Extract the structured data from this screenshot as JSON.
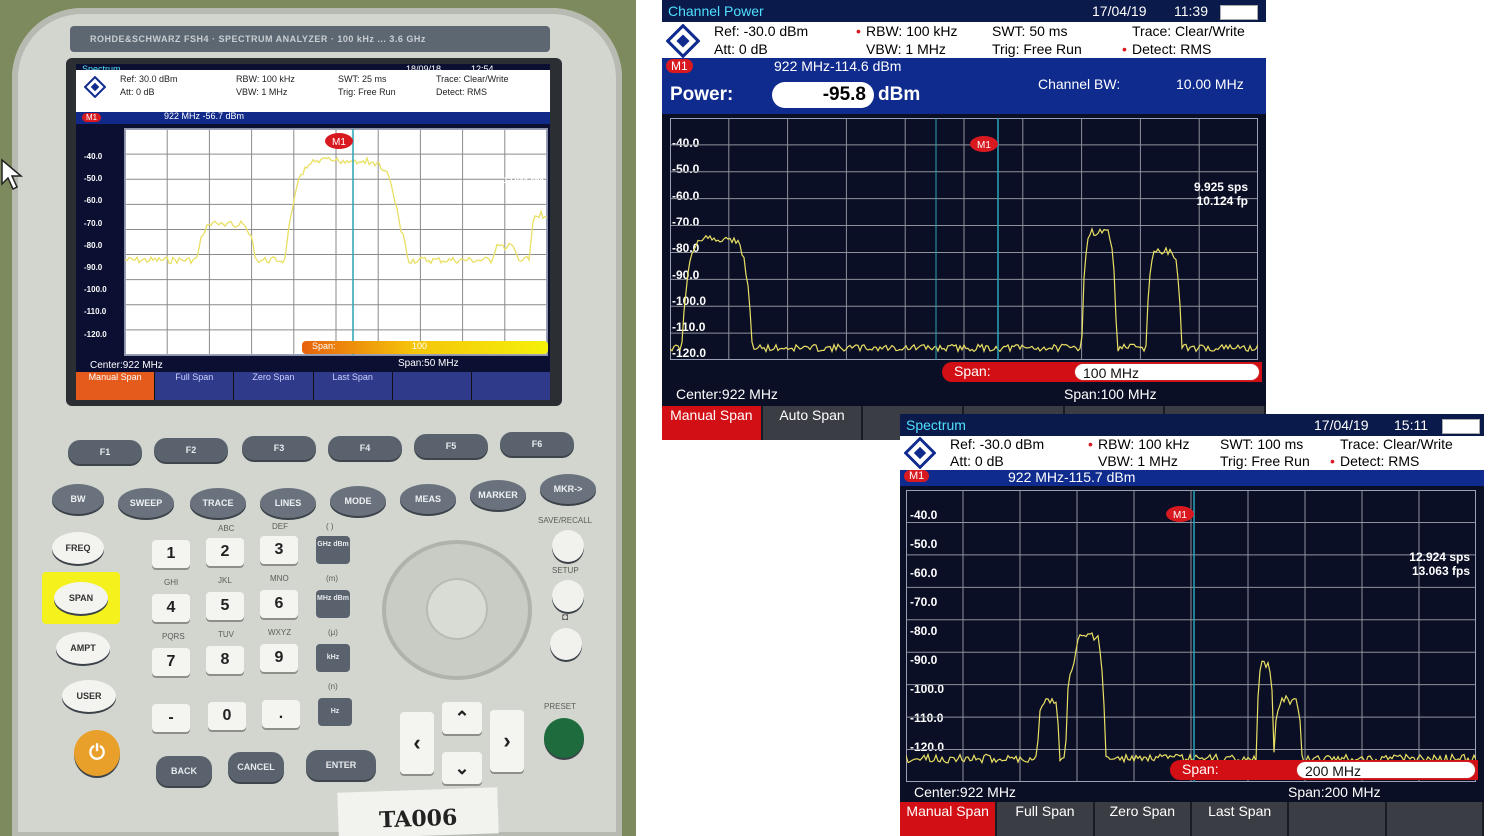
{
  "device": {
    "brand": "ROHDE&SCHWARZ  FSH4 · SPECTRUM ANALYZER · 100 kHz ... 3.6 GHz",
    "asset_tag": "TA006",
    "screen": {
      "mode": "Spectrum",
      "date": "18/09/18",
      "time": "12:54",
      "ref": "Ref:  30.0 dBm",
      "att": "Att:  0 dB",
      "rbw": "RBW:   100 kHz",
      "vbw": "VBW:   1 MHz",
      "swt": "SWT:   25 ms",
      "trig": "Trig:   Free Run",
      "trace": "Trace:   Clear/Write",
      "detect": "Detect:  RMS",
      "marker_badge": "M1",
      "marker_readout": "922  MHz  -56.7  dBm",
      "y_ticks": [
        "-40.0",
        "-50.0",
        "-60.0",
        "-70.0",
        "-80.0",
        "-90.0",
        "-100.0",
        "-110.0",
        "-120.0"
      ],
      "sweep_info": [
        "12.944 sps",
        "13.010 fps"
      ],
      "center": "Center:922 MHz",
      "span": "Span:50 MHz",
      "span_field_label": "Span:",
      "span_field_value": "100",
      "softkeys": [
        "Manual Span",
        "Full Span",
        "Zero Span",
        "Last Span",
        "",
        ""
      ]
    },
    "fkeys": [
      "F1",
      "F2",
      "F3",
      "F4",
      "F5",
      "F6"
    ],
    "func_keys": [
      "BW",
      "SWEEP",
      "TRACE",
      "LINES",
      "MODE",
      "MEAS",
      "MARKER",
      "MKR->"
    ],
    "side_keys": [
      "FREQ",
      "SPAN",
      "AMPT",
      "USER"
    ],
    "numpad": [
      "1",
      "2",
      "3",
      "4",
      "5",
      "6",
      "7",
      "8",
      "9",
      "-",
      "0",
      "."
    ],
    "numpad_letters": [
      "ABC",
      "DEF",
      "GHI",
      "JKL",
      "MNO",
      "PQRS",
      "TUV",
      "WXYZ"
    ],
    "unit_keys": [
      "GHz dBm",
      "MHz dBm",
      "kHz",
      "Hz"
    ],
    "unit_letters": [
      "( )",
      "(m)",
      "(μ)",
      "(n)"
    ],
    "bottom_keys": [
      "BACK",
      "CANCEL",
      "ENTER"
    ],
    "right_labels": [
      "SAVE/RECALL",
      "SETUP",
      "PRESET"
    ]
  },
  "channel_power": {
    "title": "Channel Power",
    "date": "17/04/19",
    "time": "11:39",
    "ref": "Ref:  -30.0 dBm",
    "att": "Att:  0 dB",
    "rbw": "RBW:   100 kHz",
    "vbw": "VBW:   1 MHz",
    "swt": "SWT:   50 ms",
    "trig": "Trig:   Free Run",
    "trace": "Trace:   Clear/Write",
    "detect": "Detect:  RMS",
    "marker_badge": "M1",
    "marker_readout": "922  MHz-114.6  dBm",
    "power_label": "Power:",
    "power_value": "-95.8",
    "power_unit": "dBm",
    "channel_bw_label": "Channel BW:",
    "channel_bw_value": "10.00 MHz",
    "y_ticks": [
      "-40.0",
      "-50.0",
      "-60.0",
      "-70.0",
      "-80.0",
      "-90.0",
      "-100.0",
      "-110.0",
      "-120.0"
    ],
    "sweep_info": [
      "9.925 sps",
      "10.124 fp"
    ],
    "span_field_label": "Span:",
    "span_field_value": "100 MHz",
    "center": "Center:922 MHz",
    "span": "Span:100 MHz",
    "softkeys": [
      "Manual Span",
      "Auto Span",
      "",
      "",
      "",
      ""
    ]
  },
  "spectrum": {
    "title": "Spectrum",
    "date": "17/04/19",
    "time": "15:11",
    "ref": "Ref:  -30.0 dBm",
    "att": "Att:  0 dB",
    "rbw": "RBW:   100 kHz",
    "vbw": "VBW:   1 MHz",
    "swt": "SWT:   100 ms",
    "trig": "Trig:   Free Run",
    "trace": "Trace:   Clear/Write",
    "detect": "Detect:  RMS",
    "marker_badge": "M1",
    "marker_readout": "922  MHz-115.7  dBm",
    "y_ticks": [
      "-40.0",
      "-50.0",
      "-60.0",
      "-70.0",
      "-80.0",
      "-90.0",
      "-100.0",
      "-110.0",
      "-120.0"
    ],
    "sweep_info": [
      "12.924 sps",
      "13.063 fps"
    ],
    "span_field_label": "Span:",
    "span_field_value": "200 MHz",
    "center": "Center:922 MHz",
    "span": "Span:200 MHz",
    "softkeys": [
      "Manual Span",
      "Full Span",
      "Zero Span",
      "Last Span",
      "",
      ""
    ]
  },
  "colors": {
    "trace": "#e9df63",
    "marker": "#d81920",
    "accent": "#4fe0ff",
    "header_blue": "#0f2b8e",
    "span_red": "#d10f14"
  }
}
